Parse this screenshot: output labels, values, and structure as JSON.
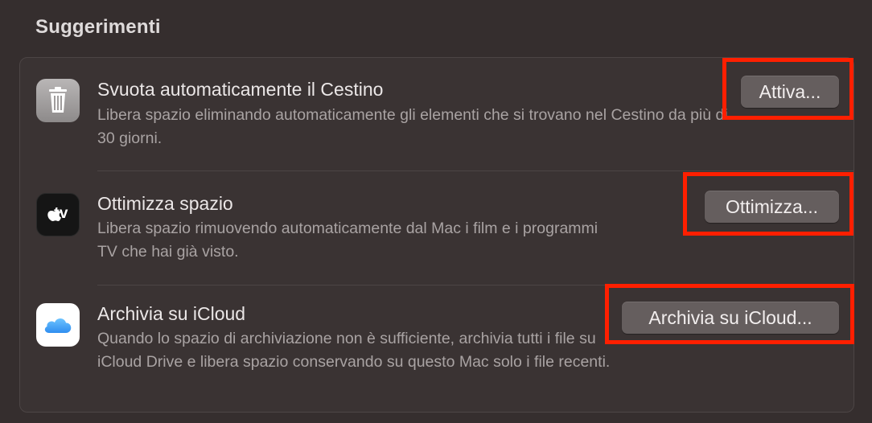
{
  "section": {
    "title": "Suggerimenti"
  },
  "rows": [
    {
      "icon": "trash-icon",
      "title": "Svuota automaticamente il Cestino",
      "description": "Libera spazio eliminando automaticamente gli elementi che si trovano nel Cestino da più di 30 giorni.",
      "button_label": "Attiva..."
    },
    {
      "icon": "apple-tv-icon",
      "icon_text": "tv",
      "title": "Ottimizza spazio",
      "description": "Libera spazio rimuovendo automaticamente dal Mac i film e i programmi TV che hai già visto.",
      "button_label": "Ottimizza..."
    },
    {
      "icon": "icloud-icon",
      "title": "Archivia su iCloud",
      "description": "Quando lo spazio di archiviazione non è sufficiente, archivia tutti i file su iCloud Drive e libera spazio conservando su questo Mac solo i file recenti.",
      "button_label": "Archivia su iCloud..."
    }
  ],
  "colors": {
    "background": "#352e2e",
    "panel": "#3a3333",
    "button": "#655e5e",
    "highlight": "#ff1f00"
  }
}
